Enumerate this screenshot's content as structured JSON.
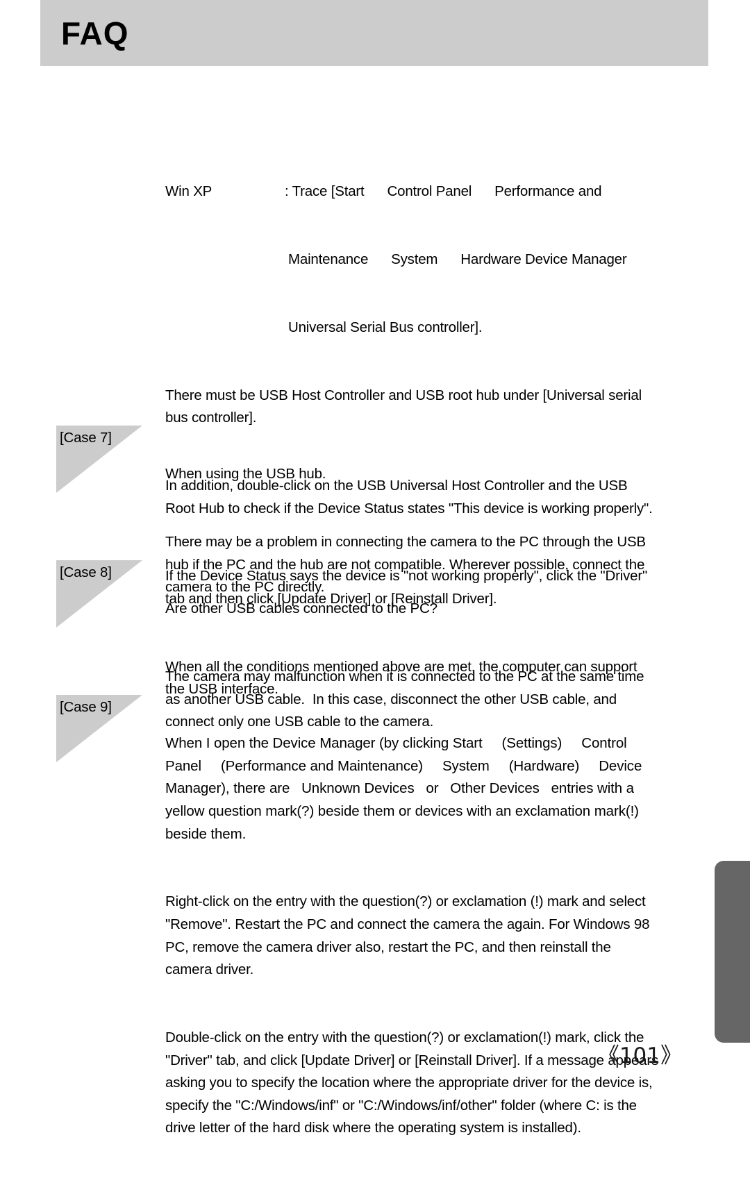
{
  "header": {
    "title": "FAQ",
    "band_color": "#cccccc"
  },
  "intro": {
    "os_label": "Win XP",
    "trace_line": ": Trace [Start      Control Panel      Performance and",
    "trace_cont_1": "Maintenance      System      Hardware Device Manager",
    "trace_cont_2": "Universal Serial Bus controller].",
    "paragraphs": [
      "There must be USB Host Controller and USB root hub under [Universal serial\nbus controller].",
      "In addition, double-click on the USB Universal Host Controller and the USB\nRoot Hub to check if the Device Status states \"This device is working properly\".",
      "If the Device Status says the device is \"not working properly\", click the \"Driver\"\ntab and then click [Update Driver] or [Reinstall Driver].",
      "When all the conditions mentioned above are met, the computer can support\nthe USB interface."
    ]
  },
  "cases": [
    {
      "label": "[Case 7]",
      "heading": "When using the USB hub.",
      "body": "There may be a problem in connecting the camera to the PC through the USB\nhub if the PC and the hub are not compatible. Wherever possible, connect the\ncamera to the PC directly."
    },
    {
      "label": "[Case 8]",
      "heading": "Are other USB cables connected to the PC?",
      "body": "The camera may malfunction when it is connected to the PC at the same time\nas another USB cable.  In this case, disconnect the other USB cable, and\nconnect only one USB cable to the camera."
    },
    {
      "label": "[Case 9]",
      "heading": "When I open the Device Manager (by clicking Start     (Settings)     Control\nPanel     (Performance and Maintenance)     System     (Hardware)     Device\nManager), there are   Unknown Devices   or   Other Devices   entries with a\nyellow question mark(?) beside them or devices with an exclamation mark(!)\nbeside them.",
      "body": "Right-click on the entry with the question(?) or exclamation (!) mark and select\n\"Remove\". Restart the PC and connect the camera the again. For Windows 98\nPC, remove the camera driver also, restart the PC, and then reinstall the\ncamera driver.",
      "body2": "Double-click on the entry with the question(?) or exclamation(!) mark, click the\n\"Driver\" tab, and click [Update Driver] or [Reinstall Driver]. If a message appears\nasking you to specify the location where the appropriate driver for the device is,\nspecify the \"C:/Windows/inf\" or \"C:/Windows/inf/other\" folder (where C: is the\ndrive letter of the hard disk where the operating system is installed)."
    }
  ],
  "footer": {
    "page_number": "《101》",
    "tab_color": "#666666"
  }
}
